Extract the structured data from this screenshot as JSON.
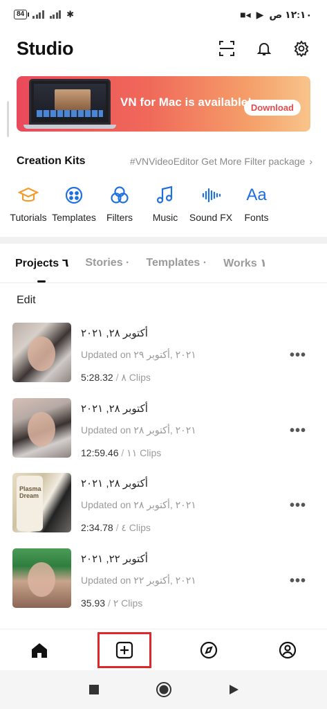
{
  "status_bar": {
    "battery": "84",
    "time": "١٢:١٠ ص"
  },
  "header": {
    "title": "Studio",
    "icons": [
      "scan-icon",
      "bell-icon",
      "gear-icon"
    ]
  },
  "banner": {
    "text": "VN for Mac is available!",
    "button": "Download"
  },
  "creation_kits": {
    "title": "Creation Kits",
    "link": "#VNVideoEditor Get More Filter package",
    "items": [
      {
        "label": "Tutorials",
        "icon": "graduation-cap-icon"
      },
      {
        "label": "Templates",
        "icon": "templates-icon"
      },
      {
        "label": "Filters",
        "icon": "filters-icon"
      },
      {
        "label": "Music",
        "icon": "music-note-icon"
      },
      {
        "label": "Sound FX",
        "icon": "sound-wave-icon"
      },
      {
        "label": "Fonts",
        "icon": "font-icon"
      }
    ]
  },
  "tabs": [
    {
      "label": "Projects ٦",
      "active": true
    },
    {
      "label": "Stories ·",
      "active": false
    },
    {
      "label": "Templates ·",
      "active": false
    },
    {
      "label": "Works ١",
      "active": false
    }
  ],
  "edit_label": "Edit",
  "projects": [
    {
      "title": "أكتوبر ٢٨, ٢٠٢١",
      "updated": "Updated on ٢٠٢١ ,أكتوبر ٢٩",
      "duration": "5:28.32",
      "clips": "٨ Clips"
    },
    {
      "title": "أكتوبر ٢٨, ٢٠٢١",
      "updated": "Updated on ٢٠٢١ ,أكتوبر ٢٨",
      "duration": "12:59.46",
      "clips": "١١ Clips"
    },
    {
      "title": "أكتوبر ٢٨, ٢٠٢١",
      "updated": "Updated on ٢٠٢١ ,أكتوبر ٢٨",
      "duration": "2:34.78",
      "clips": "٤ Clips"
    },
    {
      "title": "أكتوبر ٢٢, ٢٠٢١",
      "updated": "Updated on ٢٠٢١ ,أكتوبر ٢٢",
      "duration": "35.93",
      "clips": "٢ Clips"
    }
  ],
  "bottom_nav": [
    "home-icon",
    "add-project-icon",
    "explore-icon",
    "profile-icon"
  ],
  "colors": {
    "accent": "#f39c2b",
    "icon_blue": "#1e6fe0",
    "highlight": "#e0262b"
  }
}
